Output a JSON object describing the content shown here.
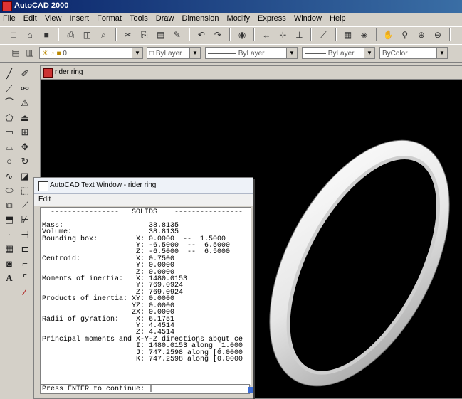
{
  "app": {
    "title": "AutoCAD 2000"
  },
  "menu": [
    "File",
    "Edit",
    "View",
    "Insert",
    "Format",
    "Tools",
    "Draw",
    "Dimension",
    "Modify",
    "Express",
    "Window",
    "Help"
  ],
  "layers": {
    "layer_value": "0",
    "color": "ByLayer",
    "linetype": "ByLayer",
    "lineweight": "ByLayer",
    "plotstyle": "ByColor"
  },
  "drawing": {
    "title": "rider ring"
  },
  "text_window": {
    "title": "AutoCAD Text Window - rider ring",
    "menu_edit": "Edit",
    "content": "  ----------------   SOLIDS    ----------------\n\nMass:                    38.8135\nVolume:                  38.8135\nBounding box:         X: 0.0000  --  1.5000\n                      Y: -6.5000  --  6.5000\n                      Z: -6.5000  --  6.5000\nCentroid:             X: 0.7500\n                      Y: 0.0000\n                      Z: 0.0000\nMoments of inertia:   X: 1480.0153\n                      Y: 769.0924\n                      Z: 769.0924\nProducts of inertia: XY: 0.0000\n                     YZ: 0.0000\n                     ZX: 0.0000\nRadii of gyration:    X: 6.1751\n                      Y: 4.4514\n                      Z: 4.4514\nPrincipal moments and X-Y-Z directions about ce\n                      I: 1480.0153 along [1.000\n                      J: 747.2598 along [0.0000\n                      K: 747.2598 along [0.0000",
    "prompt": "Press ENTER to continue: |"
  }
}
